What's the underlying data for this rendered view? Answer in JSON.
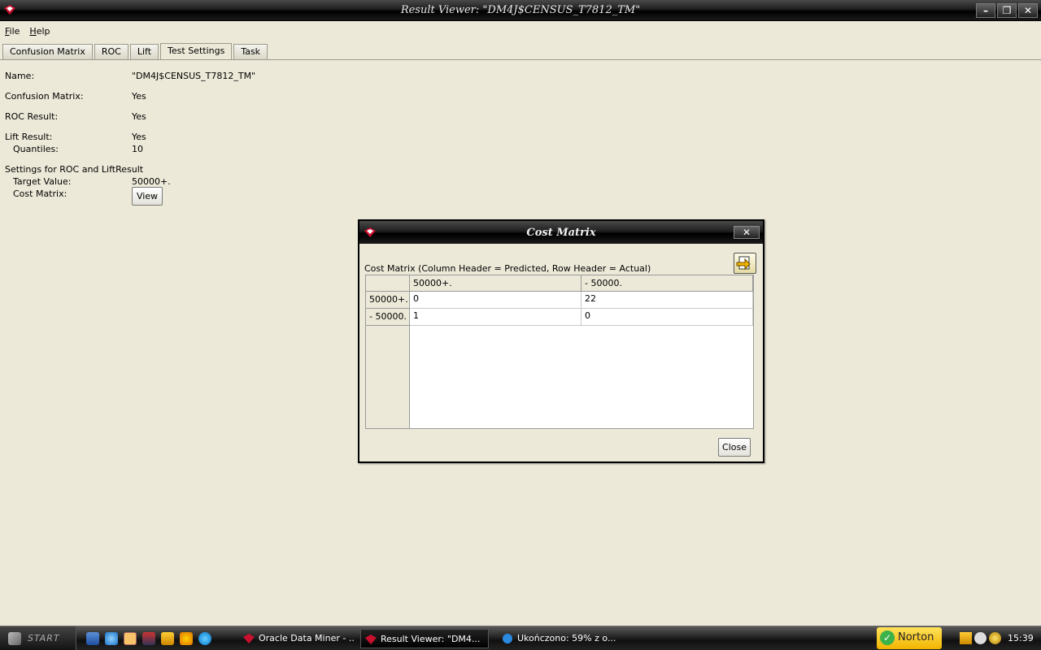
{
  "window": {
    "title": "Result Viewer: \"DM4J$CENSUS_T7812_TM\"",
    "buttons": {
      "minimize": "–",
      "restore": "❐",
      "close": "✕"
    }
  },
  "menu": {
    "items": [
      "File",
      "Help"
    ]
  },
  "tabs": [
    {
      "label": "Confusion Matrix",
      "active": false
    },
    {
      "label": "ROC",
      "active": false
    },
    {
      "label": "Lift",
      "active": false
    },
    {
      "label": "Test Settings",
      "active": true
    },
    {
      "label": "Task",
      "active": false
    }
  ],
  "settings": {
    "name_label": "Name:",
    "name_value": "\"DM4J$CENSUS_T7812_TM\"",
    "confusion_label": "Confusion Matrix:",
    "confusion_value": "Yes",
    "roc_label": "ROC Result:",
    "roc_value": "Yes",
    "lift_label": "Lift Result:",
    "lift_value": "Yes",
    "quantiles_label": "Quantiles:",
    "quantiles_value": "10",
    "section_label": "Settings for ROC and LiftResult",
    "target_label": "Target Value:",
    "target_value": "50000+.",
    "cost_label": "Cost Matrix:",
    "view_button": "View"
  },
  "dialog": {
    "title": "Cost Matrix",
    "close_glyph": "✕",
    "caption": "Cost Matrix (Column Header = Predicted, Row Header = Actual)",
    "columns": [
      "50000+.",
      "- 50000."
    ],
    "rows": [
      {
        "header": "50000+.",
        "cells": [
          "0",
          "22"
        ]
      },
      {
        "header": "- 50000.",
        "cells": [
          "1",
          "0"
        ]
      }
    ],
    "close_button": "Close"
  },
  "taskbar": {
    "start_label": "START",
    "tasks": [
      {
        "label": "Oracle Data Miner - ...",
        "active": false
      },
      {
        "label": "Result Viewer: \"DM4...",
        "active": true
      },
      {
        "label": "Ukończono: 59% z o...",
        "active": false
      }
    ],
    "norton_label": "Norton",
    "norton_check": "✓",
    "clock": "15:39"
  },
  "colors": {
    "title_bar": "#000000",
    "window_bg": "#ece9d8",
    "accent_red": "#c8102e"
  }
}
